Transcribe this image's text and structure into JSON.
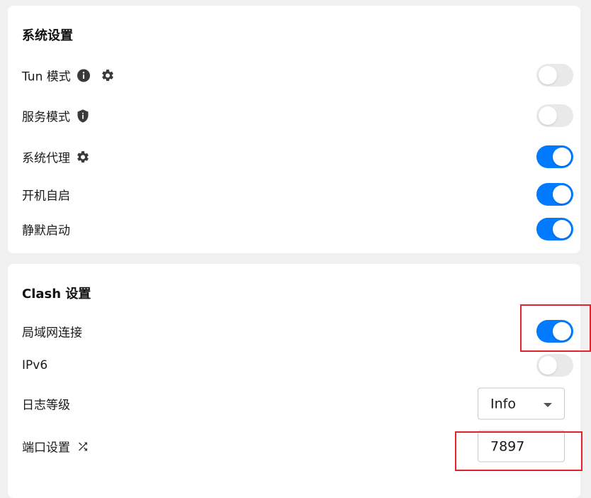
{
  "system_settings": {
    "title": "系统设置",
    "rows": [
      {
        "label": "Tun 模式",
        "icons": [
          "info-icon",
          "gear-icon"
        ],
        "enabled": false
      },
      {
        "label": "服务模式",
        "icons": [
          "shield-icon"
        ],
        "enabled": false
      },
      {
        "label": "系统代理",
        "icons": [
          "gear-icon"
        ],
        "enabled": true
      },
      {
        "label": "开机自启",
        "icons": [],
        "enabled": true
      },
      {
        "label": "静默启动",
        "icons": [],
        "enabled": true
      }
    ]
  },
  "clash_settings": {
    "title": "Clash 设置",
    "lan_connection": {
      "label": "局域网连接",
      "enabled": true
    },
    "ipv6": {
      "label": "IPv6",
      "enabled": false
    },
    "log_level": {
      "label": "日志等级",
      "value": "Info",
      "icon": "chevron-down-icon"
    },
    "port": {
      "label": "端口设置",
      "icon": "shuffle-icon",
      "value": "7897"
    }
  },
  "colors": {
    "toggle_on": "#007aff",
    "toggle_off": "#e9e9ea",
    "highlight": "#e0262b",
    "background": "#f0f0f0"
  }
}
